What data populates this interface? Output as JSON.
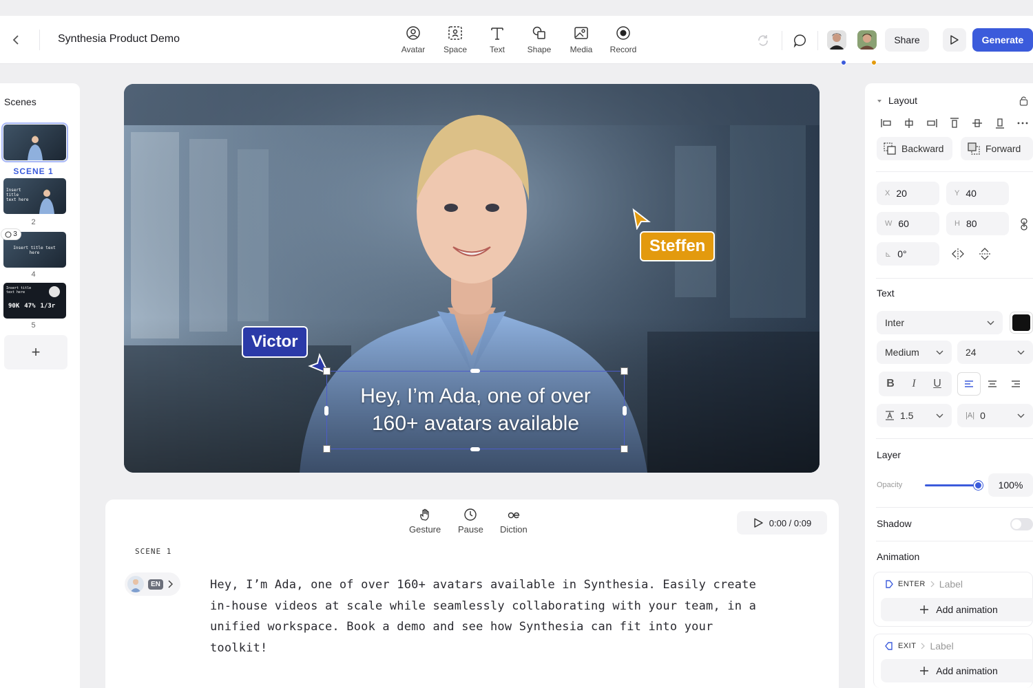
{
  "header": {
    "back_icon": "chevron-left-icon",
    "title": "Synthesia Product Demo",
    "tools": [
      {
        "label": "Avatar",
        "icon": "avatar-icon"
      },
      {
        "label": "Space",
        "icon": "space-icon"
      },
      {
        "label": "Text",
        "icon": "text-icon"
      },
      {
        "label": "Shape",
        "icon": "shape-icon"
      },
      {
        "label": "Media",
        "icon": "media-icon"
      },
      {
        "label": "Record",
        "icon": "record-icon"
      }
    ],
    "share_label": "Share",
    "generate_label": "Generate",
    "accent": "#3b5bdb"
  },
  "scenes": {
    "title": "Scenes",
    "items": [
      {
        "label": "SCENE 1",
        "thumb_text": ""
      },
      {
        "label": "2",
        "thumb_text": "Insert title text here"
      },
      {
        "label": "4",
        "thumb_text": "Insert title text here",
        "comments": "3"
      },
      {
        "label": "5",
        "thumb_text": "Insert title text here",
        "stats": [
          "90K",
          "47%",
          "1/3r"
        ]
      }
    ],
    "add_label": "+"
  },
  "canvas": {
    "subtitle_lines": [
      "Hey, I’m Ada, one of over",
      "160+ avatars available"
    ],
    "cursors": [
      {
        "name": "Victor",
        "color": "#2b3aa8"
      },
      {
        "name": "Steffen",
        "color": "#e39a0e"
      }
    ]
  },
  "script": {
    "tools": [
      {
        "label": "Gesture",
        "icon": "hand-icon"
      },
      {
        "label": "Pause",
        "icon": "clock-icon"
      },
      {
        "label": "Diction",
        "icon": "diction-icon"
      }
    ],
    "time": "0:00 / 0:09",
    "scene_tag": "SCENE 1",
    "language": "EN",
    "lines": [
      "Hey, I’m Ada, one of over 160+ avatars available in Synthesia. Easily create",
      "in-house videos at scale while seamlessly collaborating with your team, in a",
      "unified workspace. Book a demo and see how Synthesia can fit into your",
      "toolkit!"
    ]
  },
  "props": {
    "layout_title": "Layout",
    "backward_label": "Backward",
    "forward_label": "Forward",
    "x": {
      "prefix": "X",
      "value": "20"
    },
    "y": {
      "prefix": "Y",
      "value": "40"
    },
    "w": {
      "prefix": "W",
      "value": "60"
    },
    "h": {
      "prefix": "H",
      "value": "80"
    },
    "rotation": {
      "prefix": "⊾",
      "value": "0°"
    },
    "text_title": "Text",
    "font": "Inter",
    "font_color": "#111111",
    "weight": "Medium",
    "size": "24",
    "line_height": "1.5",
    "letter_spacing_prefix": "|A|",
    "letter_spacing": "0",
    "layer_title": "Layer",
    "opacity_label": "Opacity",
    "opacity_value": "100%",
    "shadow_label": "Shadow",
    "animation_title": "Animation",
    "enter_label": "ENTER",
    "exit_label": "EXIT",
    "anim_placeholder": "Label",
    "add_animation_label": "Add animation"
  }
}
